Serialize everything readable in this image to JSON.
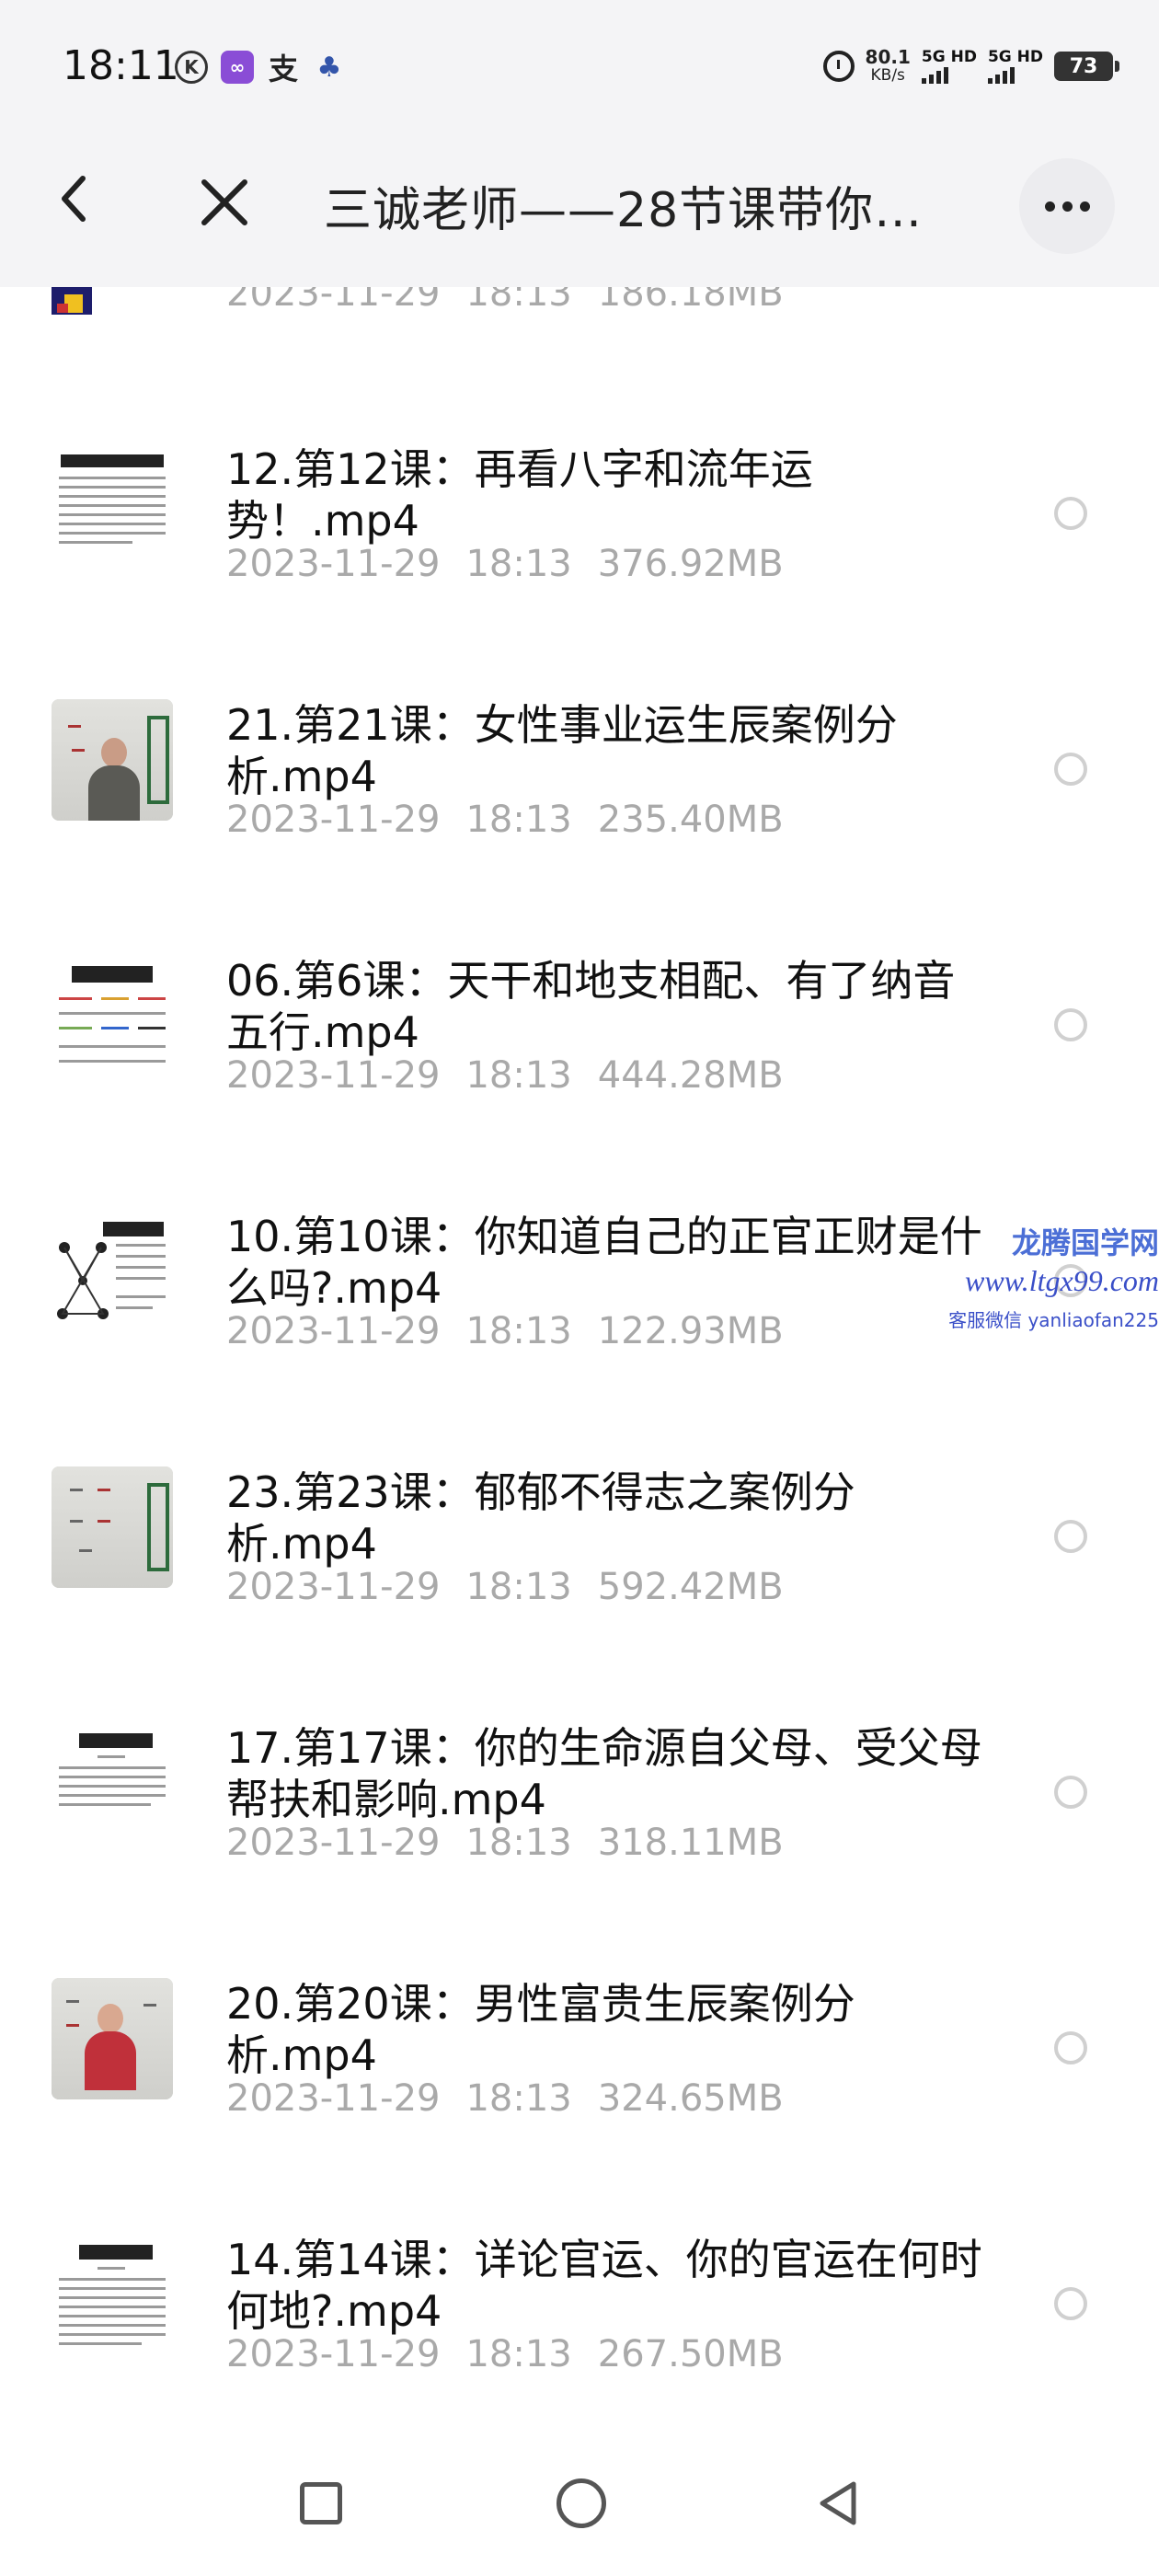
{
  "status_bar": {
    "time": "18:11",
    "net_speed_value": "80.1",
    "net_speed_unit": "KB/s",
    "signal_1_label": "5G HD",
    "signal_2_label": "5G HD",
    "battery": "73"
  },
  "header": {
    "title": "三诚老师——28节课带你…"
  },
  "files": [
    {
      "name": "",
      "date": "2023-11-29",
      "time": "18:13",
      "size": "186.18MB"
    },
    {
      "name": "12.第12课：再看八字和流年运势！.mp4",
      "date": "2023-11-29",
      "time": "18:13",
      "size": "376.92MB"
    },
    {
      "name": "21.第21课：女性事业运生辰案例分析.mp4",
      "date": "2023-11-29",
      "time": "18:13",
      "size": "235.40MB"
    },
    {
      "name": "06.第6课：天干和地支相配、有了纳音五行.mp4",
      "date": "2023-11-29",
      "time": "18:13",
      "size": "444.28MB"
    },
    {
      "name": "10.第10课：你知道自己的正官正财是什么吗?.mp4",
      "date": "2023-11-29",
      "time": "18:13",
      "size": "122.93MB"
    },
    {
      "name": "23.第23课：郁郁不得志之案例分析.mp4",
      "date": "2023-11-29",
      "time": "18:13",
      "size": "592.42MB"
    },
    {
      "name": "17.第17课：你的生命源自父母、受父母帮扶和影响.mp4",
      "date": "2023-11-29",
      "time": "18:13",
      "size": "318.11MB"
    },
    {
      "name": "20.第20课：男性富贵生辰案例分析.mp4",
      "date": "2023-11-29",
      "time": "18:13",
      "size": "324.65MB"
    },
    {
      "name": "14.第14课：详论官运、你的官运在何时何地?.mp4",
      "date": "2023-11-29",
      "time": "18:13",
      "size": "267.50MB"
    }
  ],
  "watermark": {
    "line1": "龙腾国学网",
    "line2": "www.ltgx99.com",
    "line3": "客服微信 yanliaofan225"
  },
  "icons": {
    "back": "chevron-left-icon",
    "close": "close-icon",
    "more": "more-dots-icon",
    "nav_recent": "square-icon",
    "nav_home": "circle-icon",
    "nav_back": "triangle-back-icon"
  }
}
